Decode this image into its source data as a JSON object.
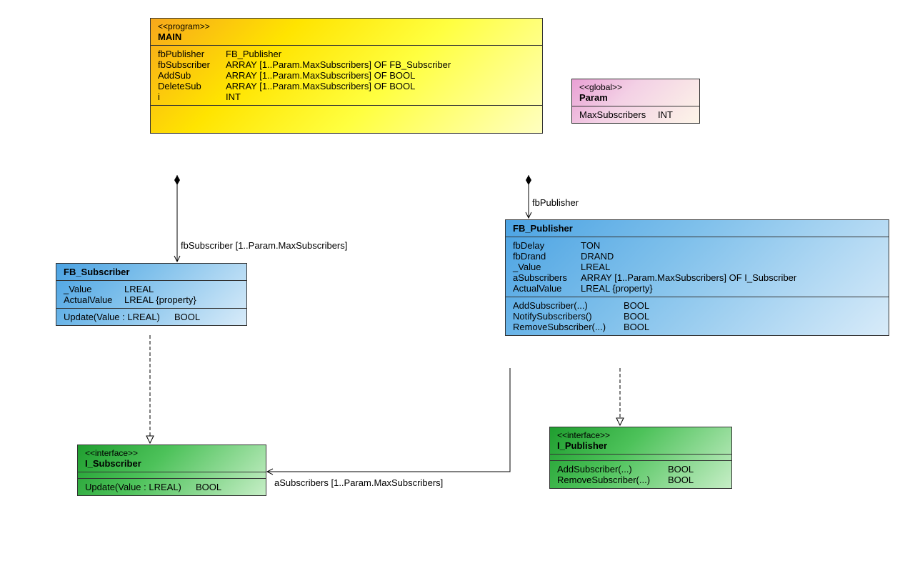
{
  "main": {
    "stereo": "<<program>>",
    "name": "MAIN",
    "attrs": [
      {
        "name": "fbPublisher",
        "type": "FB_Publisher"
      },
      {
        "name": "fbSubscriber",
        "type": "ARRAY [1..Param.MaxSubscribers] OF FB_Subscriber"
      },
      {
        "name": "AddSub",
        "type": "ARRAY [1..Param.MaxSubscribers] OF BOOL"
      },
      {
        "name": "DeleteSub",
        "type": "ARRAY [1..Param.MaxSubscribers] OF BOOL"
      },
      {
        "name": "i",
        "type": "INT"
      }
    ]
  },
  "param": {
    "stereo": "<<global>>",
    "name": "Param",
    "attrs": [
      {
        "name": "MaxSubscribers",
        "type": "INT"
      }
    ]
  },
  "fbSubscriber": {
    "name": "FB_Subscriber",
    "attrs": [
      {
        "name": "_Value",
        "type": "LREAL"
      },
      {
        "name": "ActualValue",
        "type": "LREAL {property}"
      }
    ],
    "methods": [
      {
        "name": "Update(Value : LREAL)",
        "ret": "BOOL"
      }
    ]
  },
  "fbPublisher": {
    "name": "FB_Publisher",
    "attrs": [
      {
        "name": "fbDelay",
        "type": "TON"
      },
      {
        "name": "fbDrand",
        "type": "DRAND"
      },
      {
        "name": "_Value",
        "type": "LREAL"
      },
      {
        "name": "aSubscribers",
        "type": "ARRAY [1..Param.MaxSubscribers] OF I_Subscriber"
      },
      {
        "name": "ActualValue",
        "type": "LREAL {property}"
      }
    ],
    "methods": [
      {
        "name": "AddSubscriber(...)",
        "ret": "BOOL"
      },
      {
        "name": "NotifySubscribers()",
        "ret": "BOOL"
      },
      {
        "name": "RemoveSubscriber(...)",
        "ret": "BOOL"
      }
    ]
  },
  "iSubscriber": {
    "stereo": "<<interface>>",
    "name": "I_Subscriber",
    "methods": [
      {
        "name": "Update(Value : LREAL)",
        "ret": "BOOL"
      }
    ]
  },
  "iPublisher": {
    "stereo": "<<interface>>",
    "name": "I_Publisher",
    "methods": [
      {
        "name": "AddSubscriber(...)",
        "ret": "BOOL"
      },
      {
        "name": "RemoveSubscriber(...)",
        "ret": "BOOL"
      }
    ]
  },
  "labels": {
    "fbPublisher": "fbPublisher",
    "fbSubscriber": "fbSubscriber [1..Param.MaxSubscribers]",
    "aSubscribers": "aSubscribers [1..Param.MaxSubscribers]"
  }
}
